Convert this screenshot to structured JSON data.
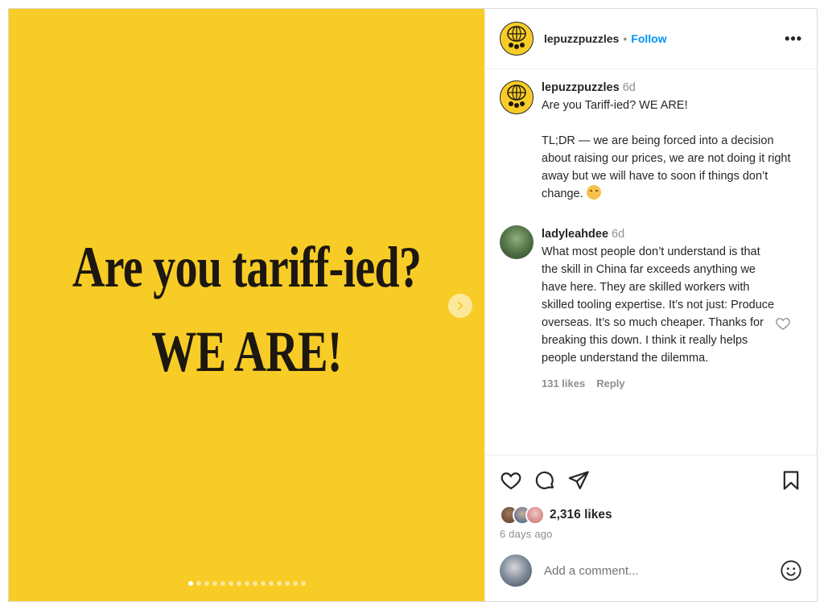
{
  "media": {
    "line1": "Are you tariff-ied?",
    "line2": "WE ARE!",
    "background": "#f8cc26",
    "slide_count": 15,
    "active_slide": 1
  },
  "header": {
    "username": "lepuzzpuzzles",
    "separator": "•",
    "follow_label": "Follow",
    "more_label": "•••"
  },
  "caption": {
    "username": "lepuzzpuzzles",
    "time": "6d",
    "line1": "Are you Tariff-ied? WE ARE!",
    "body": "TL;DR — we are being forced into a decision about raising our prices, we are not doing it right away but we will have to soon if things don’t change."
  },
  "comment": {
    "username": "ladyleahdee",
    "time": "6d",
    "text": "What most people don’t understand is that the skill in China far exceeds anything we have here. They are skilled workers with skilled tooling expertise. It’s not just: Produce overseas. It’s so much cheaper. Thanks for breaking this down. I think it really helps people understand the dilemma.",
    "likes": "131 likes",
    "reply_label": "Reply"
  },
  "post": {
    "likes": "2,316 likes",
    "posted_ago": "6 days ago"
  },
  "add_comment": {
    "placeholder": "Add a comment..."
  },
  "icons": {
    "next": "chevron-right-icon",
    "like": "heart-icon",
    "comment": "comment-icon",
    "share": "send-icon",
    "save": "bookmark-icon",
    "emoji": "smiley-icon"
  },
  "colors": {
    "accent": "#0095f6",
    "muted": "#8e8e8e",
    "text": "#262626"
  }
}
